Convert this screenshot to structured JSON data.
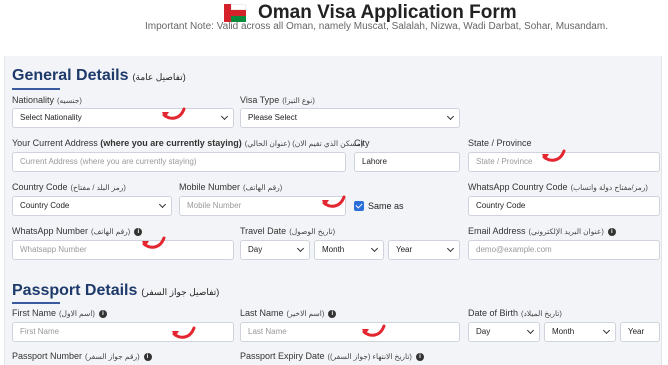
{
  "header": {
    "title": "Oman Visa Application Form",
    "note": "Important Note: Valid across all Oman, namely Muscat, Salalah, Nizwa, Wadi Darbat, Sohar, Musandam."
  },
  "general": {
    "heading": "General Details",
    "heading_ar": "(تفاصيل عامة)",
    "nationality": {
      "label": "Nationality",
      "label_ar": "(جنسيه)",
      "value": "Select Nationality"
    },
    "visa_type": {
      "label": "Visa Type",
      "label_ar": "(نوع التيزا)",
      "value": "Please Select"
    },
    "address": {
      "label": "Your Current Address",
      "label_bold": "(where you are currently staying)",
      "label_ar": "(عنوان الحالي) (مسكن الذي تقيم الان)",
      "placeholder": "Current Address (where you are currently staying)"
    },
    "city": {
      "label": "City",
      "value": "Lahore"
    },
    "state": {
      "label": "State / Province",
      "placeholder": "State / Province"
    },
    "country_code": {
      "label": "Country Code",
      "label_ar": "(رمز البلد / مفتاح)",
      "value": "Country Code"
    },
    "mobile": {
      "label": "Mobile Number",
      "label_ar": "(رقم الهاتف)",
      "placeholder": "Mobile Number"
    },
    "same_as": {
      "label": "Same as",
      "checked": true
    },
    "whatsapp_cc": {
      "label": "WhatsApp Country Code",
      "label_ar": "(رمز/مفتاح دولة واتساب)",
      "value": "Country Code"
    },
    "whatsapp": {
      "label": "WhatsApp Number",
      "label_ar": "(رقم الهاتف)",
      "placeholder": "Whatsapp Number"
    },
    "travel_date": {
      "label": "Travel Date",
      "label_ar": "(تاريخ الوصول)",
      "day": "Day",
      "month": "Month",
      "year": "Year"
    },
    "email": {
      "label": "Email Address",
      "label_ar": "(عنوان البريد الإلكتروني)",
      "placeholder": "demo@example.com"
    }
  },
  "passport": {
    "heading": "Passport Details",
    "heading_ar": "(تفاصيل جواز السفر)",
    "first_name": {
      "label": "First Name",
      "label_ar": "(اسم الاول)",
      "placeholder": "First Name"
    },
    "last_name": {
      "label": "Last Name",
      "label_ar": "(اسم الاخير)",
      "placeholder": "Last Name"
    },
    "dob": {
      "label": "Date of Birth",
      "label_ar": "(تاريخ الميلاد)",
      "day": "Day",
      "month": "Month",
      "year": "Year"
    },
    "passport_number": {
      "label": "Passport Number",
      "label_ar": "(رقم جواز السفر)"
    },
    "passport_expiry": {
      "label": "Passport Expiry Date",
      "label_ar": "(تاريخ الانتهاء (جواز السفر))"
    }
  },
  "colors": {
    "accent": "#1e3a6b",
    "arrow": "#e3262f",
    "checkbox": "#2b6fd9",
    "panel": "#f3f4f7"
  }
}
